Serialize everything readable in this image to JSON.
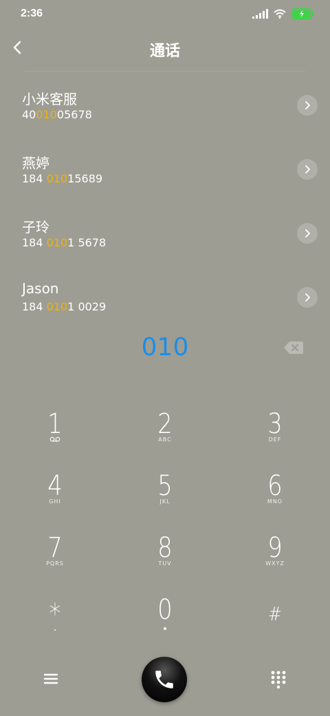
{
  "status_bar": {
    "time": "2:36"
  },
  "header": {
    "title": "通话"
  },
  "contacts": [
    {
      "name": "小米客服",
      "number_pre": "40",
      "number_match": "010",
      "number_post": "05678"
    },
    {
      "name": "燕婷",
      "number_pre": "184 ",
      "number_match": "010",
      "number_post": "15689"
    },
    {
      "name": "子玲",
      "number_pre": "184 ",
      "number_match": "010",
      "number_post": "1 5678"
    },
    {
      "name": "Jason",
      "number_pre": "184 ",
      "number_match": "010",
      "number_post": "1 0029"
    }
  ],
  "dial_input": {
    "value": "010"
  },
  "keypad": {
    "keys": [
      {
        "digit": "1",
        "letters": ""
      },
      {
        "digit": "2",
        "letters": "ABC"
      },
      {
        "digit": "3",
        "letters": "DEF"
      },
      {
        "digit": "4",
        "letters": "GHI"
      },
      {
        "digit": "5",
        "letters": "JKL"
      },
      {
        "digit": "6",
        "letters": "MNO"
      },
      {
        "digit": "7",
        "letters": "PQRS"
      },
      {
        "digit": "8",
        "letters": "TUV"
      },
      {
        "digit": "9",
        "letters": "WXYZ"
      },
      {
        "digit": "*",
        "letters": ""
      },
      {
        "digit": "0",
        "letters": ""
      },
      {
        "digit": "#",
        "letters": ""
      }
    ]
  },
  "colors": {
    "background": "#9e9d93",
    "match_highlight": "#f0b400",
    "dial_input": "#1c8ee6",
    "battery": "#3fd24a"
  },
  "icons": {
    "back": "chevron-left-icon",
    "detail": "chevron-right-icon",
    "backspace": "backspace-icon",
    "voicemail": "voicemail-icon",
    "menu": "hamburger-icon",
    "call": "phone-icon",
    "keypad_toggle": "dialpad-icon"
  }
}
